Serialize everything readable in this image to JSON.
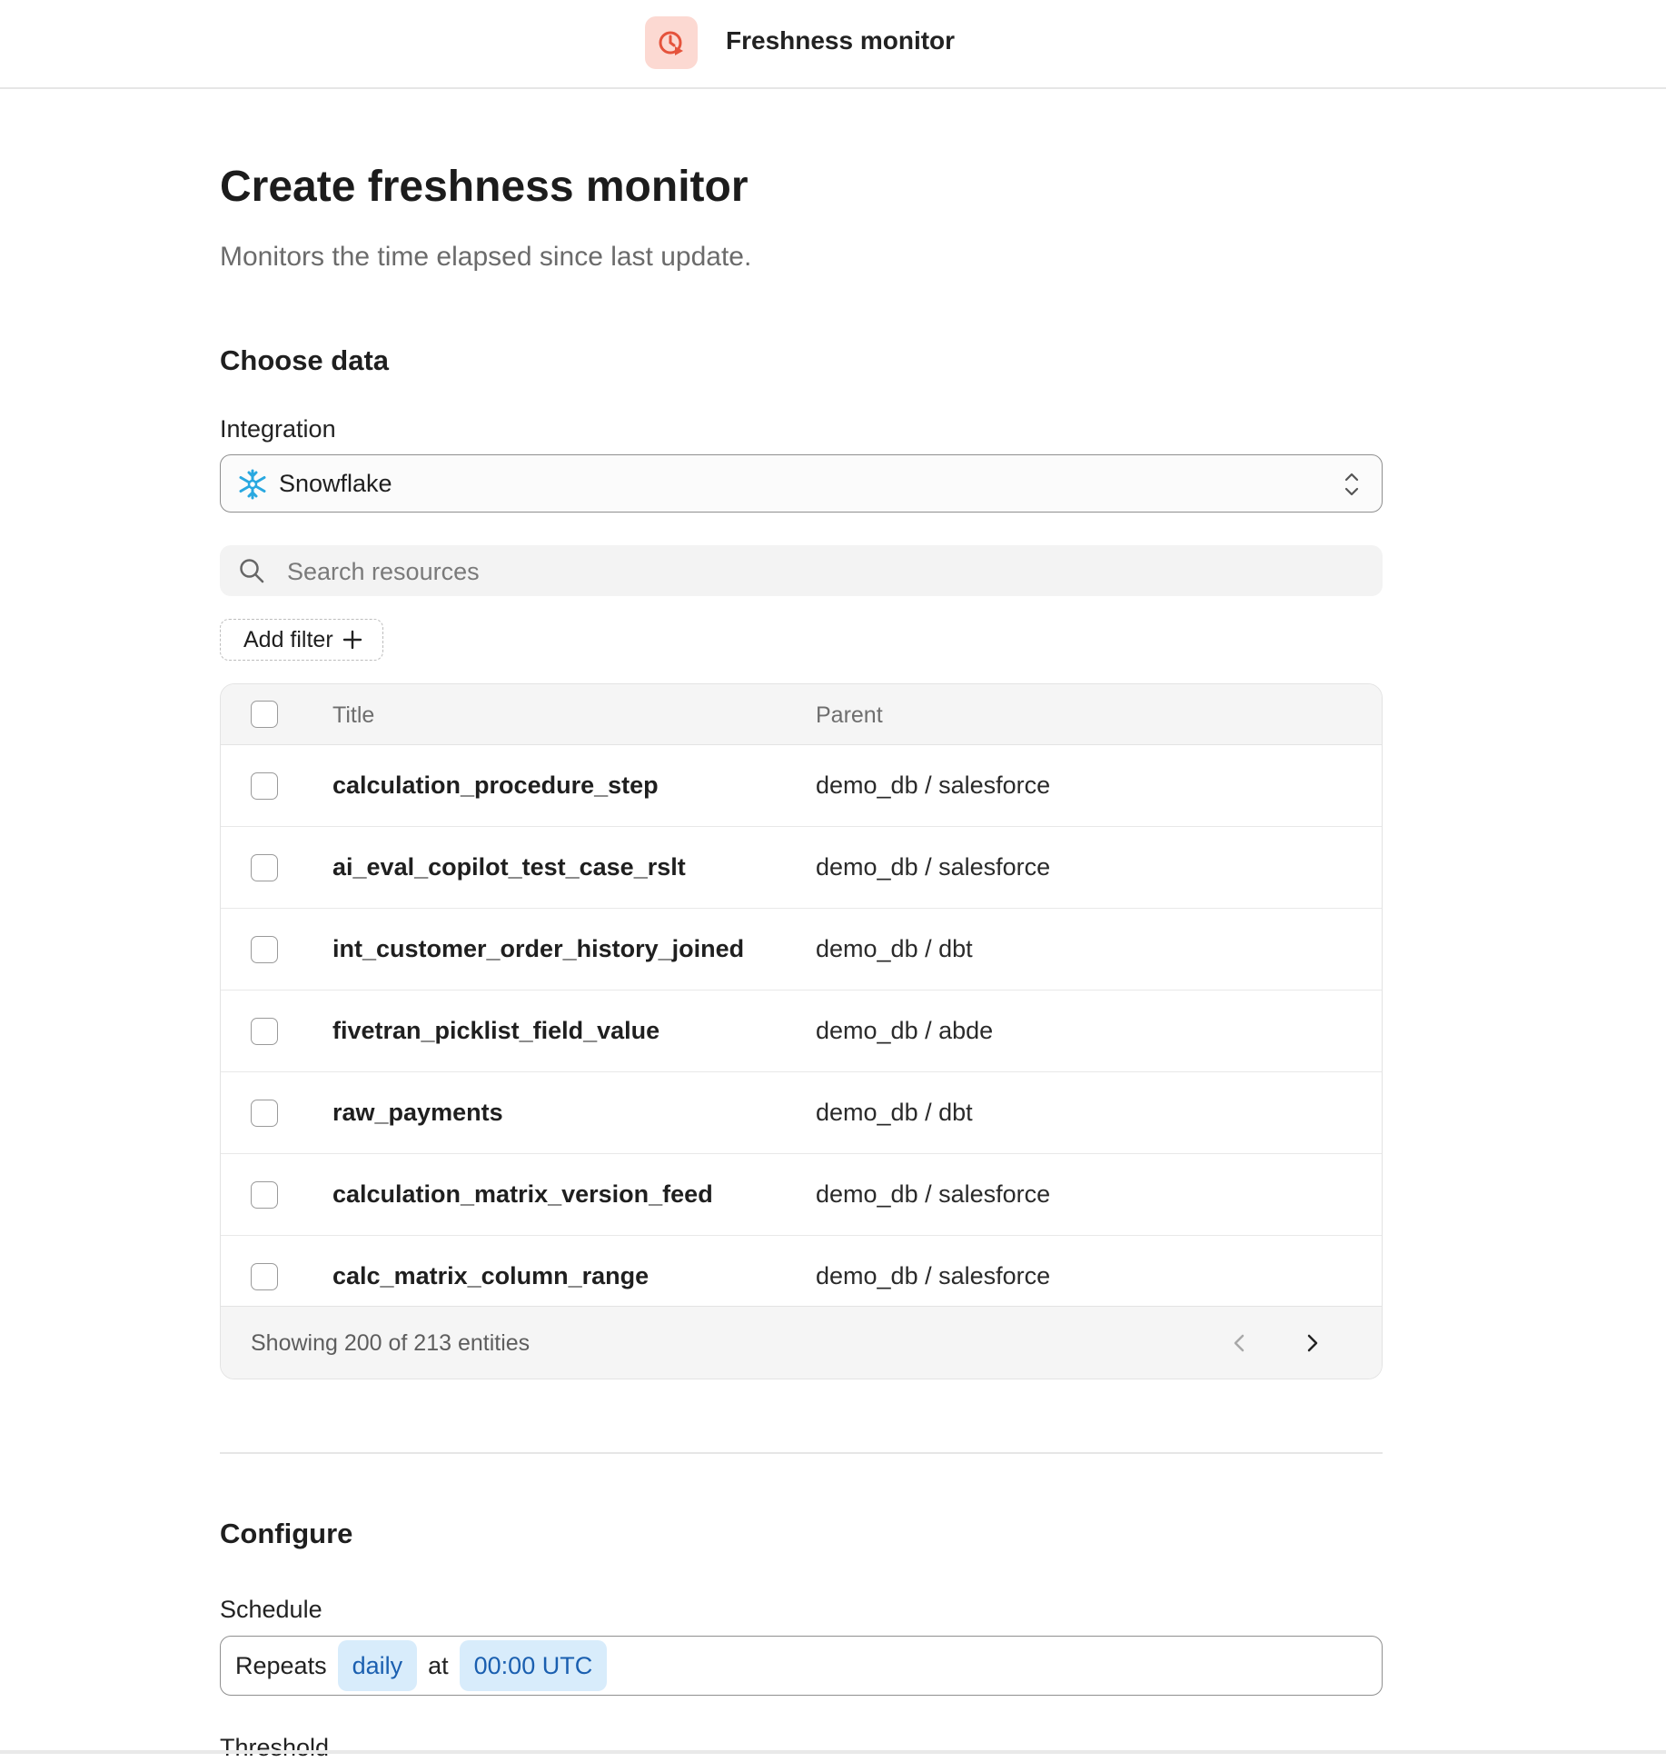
{
  "header": {
    "app_title": "Freshness monitor",
    "app_icon": "clock-alert-icon",
    "accent_color": "#e5533c",
    "accent_bg": "#fcd9d2"
  },
  "page": {
    "title": "Create freshness monitor",
    "subtitle": "Monitors the time elapsed since last update."
  },
  "choose_data": {
    "heading": "Choose data",
    "integration": {
      "label": "Integration",
      "value": "Snowflake",
      "icon": "snowflake-icon",
      "icon_color": "#29a8e0"
    },
    "search": {
      "placeholder": "Search resources"
    },
    "add_filter_label": "Add filter"
  },
  "table": {
    "columns": {
      "title": "Title",
      "parent": "Parent"
    },
    "rows": [
      {
        "title": "calculation_procedure_step",
        "parent": "demo_db / salesforce"
      },
      {
        "title": "ai_eval_copilot_test_case_rslt",
        "parent": "demo_db / salesforce"
      },
      {
        "title": "int_customer_order_history_joined",
        "parent": "demo_db / dbt"
      },
      {
        "title": "fivetran_picklist_field_value",
        "parent": "demo_db / abde"
      },
      {
        "title": "raw_payments",
        "parent": "demo_db / dbt"
      },
      {
        "title": "calculation_matrix_version_feed",
        "parent": "demo_db / salesforce"
      },
      {
        "title": "calc_matrix_column_range",
        "parent": "demo_db / salesforce"
      }
    ],
    "footer": "Showing 200 of 213 entities"
  },
  "configure": {
    "heading": "Configure",
    "schedule": {
      "label": "Schedule",
      "repeats_text": "Repeats",
      "frequency": "daily",
      "at_text": "at",
      "time": "00:00 UTC",
      "chip_bg": "#d8ecfb",
      "chip_color": "#1a5fb0"
    },
    "threshold_label": "Threshold"
  }
}
